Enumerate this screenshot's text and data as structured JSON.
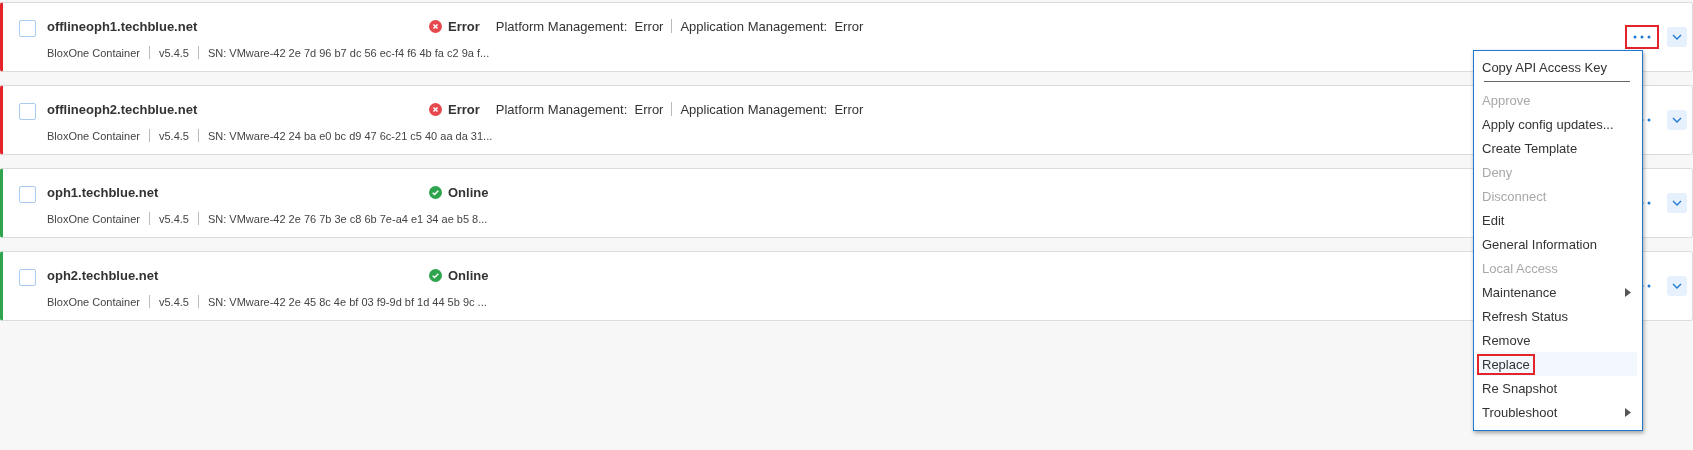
{
  "hosts": [
    {
      "name": "offlineoph1.techblue.net",
      "kind": "error",
      "status_label": "Error",
      "details": [
        {
          "label": "Platform Management:",
          "value": "Error"
        },
        {
          "label": "Application Management:",
          "value": "Error"
        }
      ],
      "type": "BloxOne Container",
      "version": "v5.4.5",
      "serial": "SN: VMware-42 2e 7d 96 b7 dc 56 ec-f4 f6 4b fa c2 9a f...",
      "checked": false,
      "annotated": true
    },
    {
      "name": "offlineoph2.techblue.net",
      "kind": "error",
      "status_label": "Error",
      "details": [
        {
          "label": "Platform Management:",
          "value": "Error"
        },
        {
          "label": "Application Management:",
          "value": "Error"
        }
      ],
      "type": "BloxOne Container",
      "version": "v5.4.5",
      "serial": "SN: VMware-42 24 ba e0 bc d9 47 6c-21 c5 40 aa da 31...",
      "checked": false,
      "annotated": false
    },
    {
      "name": "oph1.techblue.net",
      "kind": "online",
      "status_label": "Online",
      "type": "BloxOne Container",
      "version": "v5.4.5",
      "serial": "SN: VMware-42 2e 76 7b 3e c8 6b 7e-a4 e1 34 ae b5 8...",
      "checked": false,
      "annotated": false
    },
    {
      "name": "oph2.techblue.net",
      "kind": "online",
      "status_label": "Online",
      "type": "BloxOne Container",
      "version": "v5.4.5",
      "serial": "SN: VMware-42 2e 45 8c 4e bf 03 f9-9d bf 1d 44 5b 9c ...",
      "checked": false,
      "annotated": false
    }
  ],
  "menu": {
    "items": [
      {
        "label": "Copy API Access Key",
        "disabled": false,
        "submenu": false,
        "divider_after": true,
        "hovered": false,
        "annotated": false
      },
      {
        "label": "Approve",
        "disabled": true,
        "submenu": false,
        "divider_after": false,
        "hovered": false,
        "annotated": false
      },
      {
        "label": "Apply config updates...",
        "disabled": false,
        "submenu": false,
        "divider_after": false,
        "hovered": false,
        "annotated": false
      },
      {
        "label": "Create Template",
        "disabled": false,
        "submenu": false,
        "divider_after": false,
        "hovered": false,
        "annotated": false
      },
      {
        "label": "Deny",
        "disabled": true,
        "submenu": false,
        "divider_after": false,
        "hovered": false,
        "annotated": false
      },
      {
        "label": "Disconnect",
        "disabled": true,
        "submenu": false,
        "divider_after": false,
        "hovered": false,
        "annotated": false
      },
      {
        "label": "Edit",
        "disabled": false,
        "submenu": false,
        "divider_after": false,
        "hovered": false,
        "annotated": false
      },
      {
        "label": "General Information",
        "disabled": false,
        "submenu": false,
        "divider_after": false,
        "hovered": false,
        "annotated": false
      },
      {
        "label": "Local Access",
        "disabled": true,
        "submenu": false,
        "divider_after": false,
        "hovered": false,
        "annotated": false
      },
      {
        "label": "Maintenance",
        "disabled": false,
        "submenu": true,
        "divider_after": false,
        "hovered": false,
        "annotated": false
      },
      {
        "label": "Refresh Status",
        "disabled": false,
        "submenu": false,
        "divider_after": false,
        "hovered": false,
        "annotated": false
      },
      {
        "label": "Remove",
        "disabled": false,
        "submenu": false,
        "divider_after": false,
        "hovered": false,
        "annotated": false
      },
      {
        "label": "Replace",
        "disabled": false,
        "submenu": false,
        "divider_after": false,
        "hovered": true,
        "annotated": true
      },
      {
        "label": "Re Snapshot",
        "disabled": false,
        "submenu": false,
        "divider_after": false,
        "hovered": false,
        "annotated": false
      },
      {
        "label": "Troubleshoot",
        "disabled": false,
        "submenu": true,
        "divider_after": false,
        "hovered": false,
        "annotated": false
      }
    ]
  }
}
